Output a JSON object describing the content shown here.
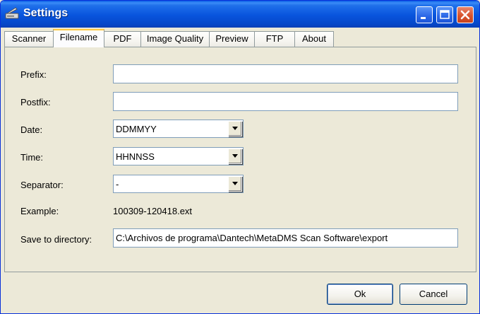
{
  "window": {
    "title": "Settings"
  },
  "tabs": [
    {
      "label": "Scanner"
    },
    {
      "label": "Filename"
    },
    {
      "label": "PDF"
    },
    {
      "label": "Image Quality"
    },
    {
      "label": "Preview"
    },
    {
      "label": "FTP"
    },
    {
      "label": "About"
    }
  ],
  "active_tab": "Filename",
  "form": {
    "prefix": {
      "label": "Prefix:",
      "value": ""
    },
    "postfix": {
      "label": "Postfix:",
      "value": ""
    },
    "date": {
      "label": "Date:",
      "value": "DDMMYY"
    },
    "time": {
      "label": "Time:",
      "value": "HHNNSS"
    },
    "separator": {
      "label": "Separator:",
      "value": "-"
    },
    "example": {
      "label": "Example:",
      "value": "100309-120418.ext"
    },
    "save_dir": {
      "label": "Save to directory:",
      "value": "C:\\Archivos de programa\\Dantech\\MetaDMS Scan Software\\export"
    }
  },
  "buttons": {
    "ok": "Ok",
    "cancel": "Cancel"
  },
  "colors": {
    "titlebar": "#0854dd",
    "face": "#ece9d8",
    "active_tab_highlight": "#ffc83c",
    "close_button": "#d8532d"
  }
}
